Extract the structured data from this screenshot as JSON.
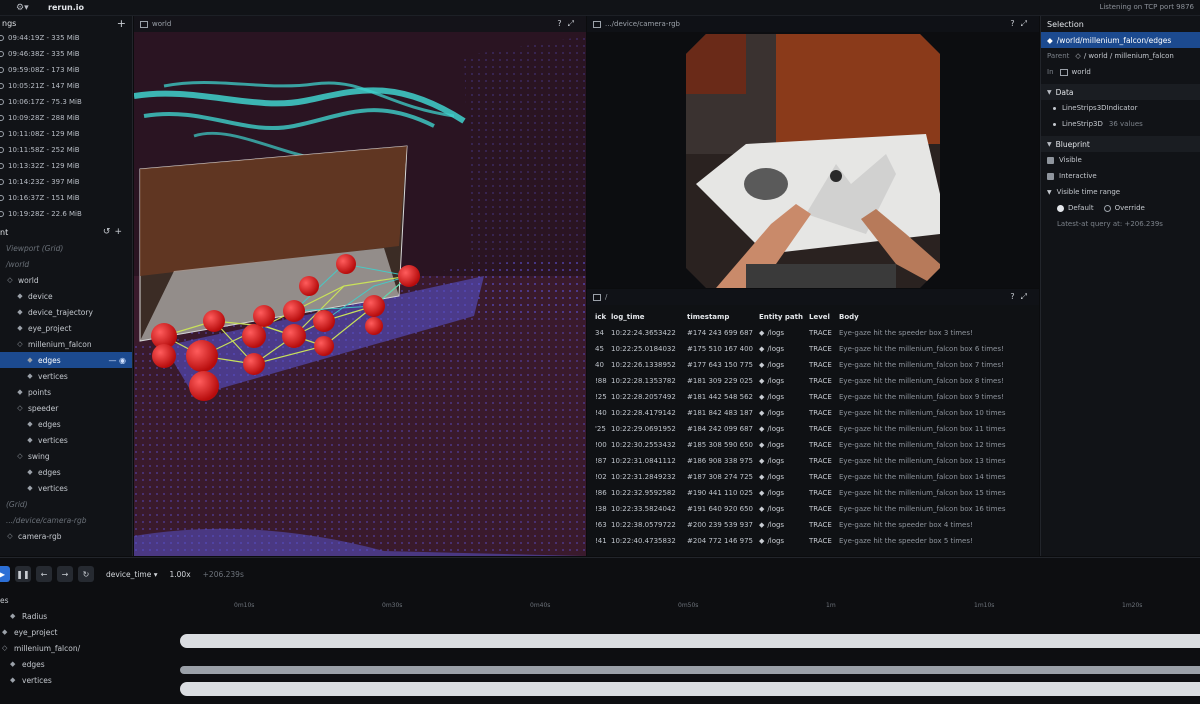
{
  "topbar": {
    "app_name": "rerun.io",
    "status": "Listening on TCP port 9876"
  },
  "recordings": {
    "header": "ngs",
    "items": [
      "09:44:19Z - 335 MiB",
      "09:46:38Z - 335 MiB",
      "09:59:08Z - 173 MiB",
      "10:05:21Z - 147 MiB",
      "10:06:17Z - 75.3 MiB",
      "10:09:28Z - 288 MiB",
      "10:11:08Z - 129 MiB",
      "10:11:58Z - 252 MiB",
      "10:13:32Z - 129 MiB",
      "10:14:23Z - 397 MiB",
      "10:16:37Z - 151 MiB",
      "10:19:28Z - 22.6 MiB"
    ]
  },
  "blueprint": {
    "header": "nt",
    "tree": [
      {
        "label": "Viewport (Grid)",
        "style": "dim",
        "indent": 0,
        "icon": ""
      },
      {
        "label": "/world",
        "style": "dim",
        "indent": 0,
        "icon": ""
      },
      {
        "label": "world",
        "style": "",
        "indent": 0,
        "icon": "◇"
      },
      {
        "label": "device",
        "style": "",
        "indent": 1,
        "icon": "◆"
      },
      {
        "label": "device_trajectory",
        "style": "",
        "indent": 1,
        "icon": "◆"
      },
      {
        "label": "eye_project",
        "style": "",
        "indent": 1,
        "icon": "◆"
      },
      {
        "label": "millenium_falcon",
        "style": "",
        "indent": 1,
        "icon": "◇"
      },
      {
        "label": "edges",
        "style": "sel",
        "indent": 2,
        "icon": "◆"
      },
      {
        "label": "vertices",
        "style": "",
        "indent": 2,
        "icon": "◆"
      },
      {
        "label": "points",
        "style": "",
        "indent": 1,
        "icon": "◆"
      },
      {
        "label": "speeder",
        "style": "",
        "indent": 1,
        "icon": "◇"
      },
      {
        "label": "edges",
        "style": "",
        "indent": 2,
        "icon": "◆"
      },
      {
        "label": "vertices",
        "style": "",
        "indent": 2,
        "icon": "◆"
      },
      {
        "label": "swing",
        "style": "",
        "indent": 1,
        "icon": "◇"
      },
      {
        "label": "edges",
        "style": "",
        "indent": 2,
        "icon": "◆"
      },
      {
        "label": "vertices",
        "style": "",
        "indent": 2,
        "icon": "◆"
      },
      {
        "label": "(Grid)",
        "style": "dim",
        "indent": 0,
        "icon": ""
      },
      {
        "label": ".../device/camera-rgb",
        "style": "dim",
        "indent": 0,
        "icon": ""
      },
      {
        "label": "camera-rgb",
        "style": "",
        "indent": 0,
        "icon": "◇"
      }
    ]
  },
  "view3d": {
    "title": "world"
  },
  "viewcam": {
    "title": ".../device/camera-rgb"
  },
  "viewlog": {
    "title": "/",
    "columns": [
      "ick",
      "log_time",
      "timestamp",
      "Entity path",
      "Level",
      "Body"
    ],
    "rows": [
      [
        "34",
        "10:22:24.3653422",
        "#174 243 699 687",
        "/logs",
        "TRACE",
        "Eye-gaze hit the speeder box 3 times!"
      ],
      [
        "45",
        "10:22:25.0184032",
        "#175 510 167 400",
        "/logs",
        "TRACE",
        "Eye-gaze hit the millenium_falcon box 6 times!"
      ],
      [
        "40",
        "10:22:26.1338952",
        "#177 643 150 775",
        "/logs",
        "TRACE",
        "Eye-gaze hit the millenium_falcon box 7 times!"
      ],
      [
        "!88",
        "10:22:28.1353782",
        "#181 309 229 025",
        "/logs",
        "TRACE",
        "Eye-gaze hit the millenium_falcon box 8 times!"
      ],
      [
        "!25",
        "10:22:28.2057492",
        "#181 442 548 562",
        "/logs",
        "TRACE",
        "Eye-gaze hit the millenium_falcon box 9 times!"
      ],
      [
        "!40",
        "10:22:28.4179142",
        "#181 842 483 187",
        "/logs",
        "TRACE",
        "Eye-gaze hit the millenium_falcon box 10 times"
      ],
      [
        "'25",
        "10:22:29.0691952",
        "#184 242 099 687",
        "/logs",
        "TRACE",
        "Eye-gaze hit the millenium_falcon box 11 times"
      ],
      [
        "!00",
        "10:22:30.2553432",
        "#185 308 590 650",
        "/logs",
        "TRACE",
        "Eye-gaze hit the millenium_falcon box 12 times"
      ],
      [
        "!87",
        "10:22:31.0841112",
        "#186 908 338 975",
        "/logs",
        "TRACE",
        "Eye-gaze hit the millenium_falcon box 13 times"
      ],
      [
        "!02",
        "10:22:31.2849232",
        "#187 308 274 725",
        "/logs",
        "TRACE",
        "Eye-gaze hit the millenium_falcon box 14 times"
      ],
      [
        "!86",
        "10:22:32.9592582",
        "#190 441 110 025",
        "/logs",
        "TRACE",
        "Eye-gaze hit the millenium_falcon box 15 times"
      ],
      [
        "!38",
        "10:22:33.5824042",
        "#191 640 920 650",
        "/logs",
        "TRACE",
        "Eye-gaze hit the millenium_falcon box 16 times"
      ],
      [
        "!63",
        "10:22:38.0579722",
        "#200 239 539 937",
        "/logs",
        "TRACE",
        "Eye-gaze hit the speeder box 4 times!"
      ],
      [
        "!41",
        "10:22:40.4735832",
        "#204 772 146 975",
        "/logs",
        "TRACE",
        "Eye-gaze hit the speeder box 5 times!"
      ]
    ]
  },
  "selection": {
    "header": "Selection",
    "selected_path": "/world/millenium_falcon/edges",
    "parent_label": "Parent",
    "parent_value": "/ world / millenium_falcon",
    "in_label": "In",
    "in_value": "world",
    "data_header": "Data",
    "data_items": [
      {
        "name": "LineStrips3DIndicator",
        "value": ""
      },
      {
        "name": "LineStrip3D",
        "value": "36 values"
      }
    ],
    "blueprint_header": "Blueprint",
    "visible_label": "Visible",
    "interactive_label": "Interactive",
    "time_range_label": "Visible time range",
    "default_label": "Default",
    "override_label": "Override",
    "latest_at": "Latest-at query at: +206.239s"
  },
  "timeline": {
    "timeline_name": "device_time",
    "speed": "1.00x",
    "current_time": "+206.239s",
    "tree_header": "es",
    "tree": [
      {
        "label": "Radius",
        "icon": "◆",
        "indent": 1
      },
      {
        "label": "eye_project",
        "icon": "◆",
        "indent": 0
      },
      {
        "label": "millenium_falcon/",
        "icon": "◇",
        "indent": 0
      },
      {
        "label": "edges",
        "icon": "◆",
        "indent": 1
      },
      {
        "label": "vertices",
        "icon": "◆",
        "indent": 1
      }
    ],
    "ticks": [
      "0m10s",
      "0m30s",
      "0m40s",
      "0m50s",
      "1m",
      "1m10s",
      "1m20s"
    ]
  }
}
